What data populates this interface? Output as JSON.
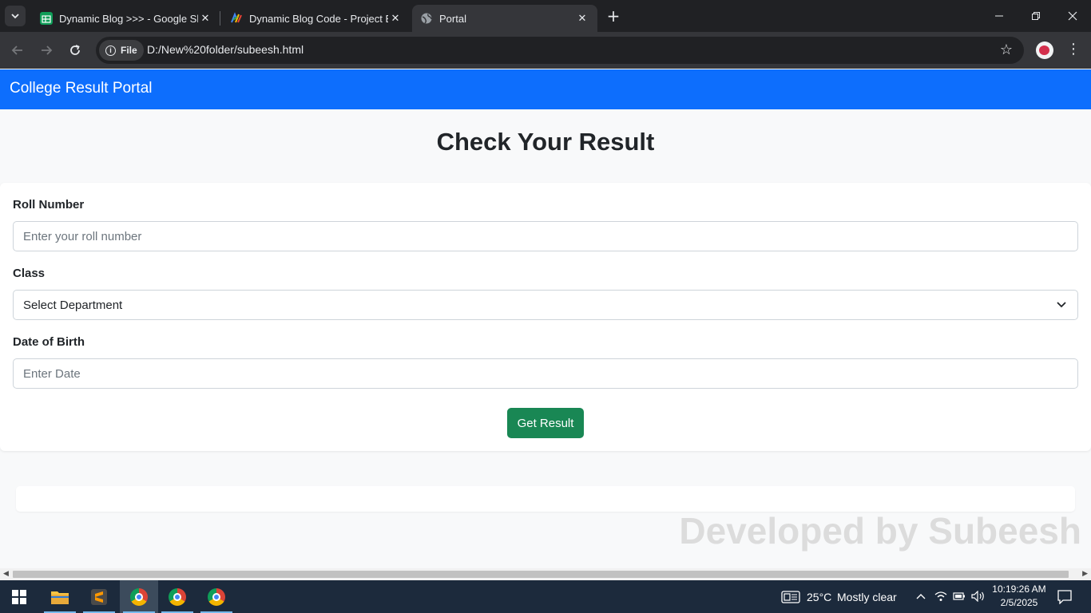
{
  "browser": {
    "tabs": [
      {
        "title": "Dynamic Blog >>> - Google Sh",
        "favicon": "google-sheets-icon",
        "active": false
      },
      {
        "title": "Dynamic Blog Code - Project Ed",
        "favicon": "gemini-project-icon",
        "active": false
      },
      {
        "title": "Portal",
        "favicon": "globe-icon",
        "active": true
      }
    ],
    "site_chip_label": "File",
    "url": "D:/New%20folder/subeesh.html"
  },
  "page": {
    "brand": "College Result Portal",
    "heading": "Check Your Result",
    "form": {
      "roll_label": "Roll Number",
      "roll_placeholder": "Enter your roll number",
      "class_label": "Class",
      "class_selected": "Select Department",
      "dob_label": "Date of Birth",
      "dob_placeholder": "Enter Date",
      "submit_label": "Get Result"
    },
    "watermark": "Developed by Subeesh"
  },
  "colors": {
    "navbar": "#0d6efd",
    "button": "#198754",
    "tabbar": "#202124",
    "taskbar": "#1c2a3c"
  },
  "taskbar": {
    "weather_temp": "25°C",
    "weather_desc": "Mostly clear",
    "time": "10:19:26 AM",
    "date": "2/5/2025"
  }
}
